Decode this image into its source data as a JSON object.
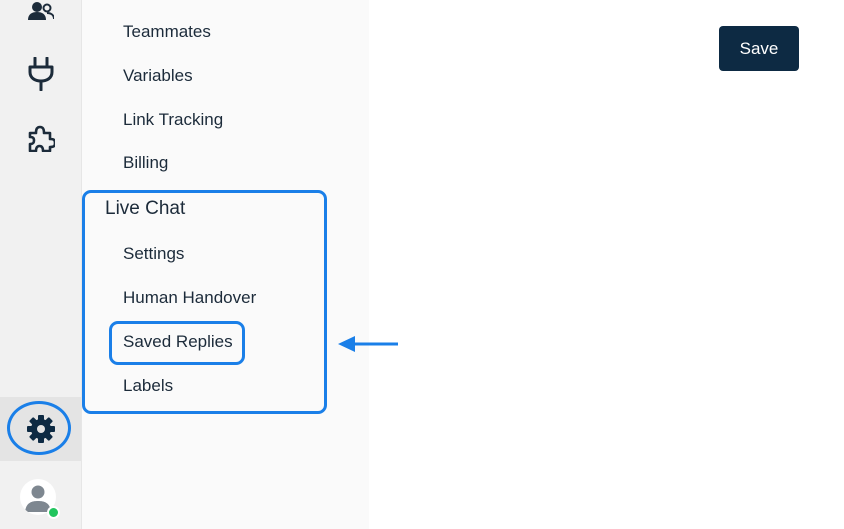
{
  "rail": {
    "icons": [
      "contacts-icon",
      "integrations-plug-icon",
      "apps-puzzle-icon",
      "settings-gear-icon",
      "user-avatar-icon"
    ],
    "active": "settings-gear-icon",
    "avatar_status": "online"
  },
  "menu": {
    "items_top": [
      {
        "label": "Teammates"
      },
      {
        "label": "Variables"
      },
      {
        "label": "Link Tracking"
      },
      {
        "label": "Billing"
      }
    ],
    "live_chat": {
      "title": "Live Chat",
      "items": [
        {
          "label": "Settings"
        },
        {
          "label": "Human Handover"
        },
        {
          "label": "Saved Replies"
        },
        {
          "label": "Labels"
        }
      ]
    }
  },
  "toolbar": {
    "save_label": "Save"
  },
  "colors": {
    "accent_highlight": "#1a7fe8",
    "primary_button": "#0d2a43",
    "text": "#1c2b3a",
    "online_status": "#22c55e"
  }
}
